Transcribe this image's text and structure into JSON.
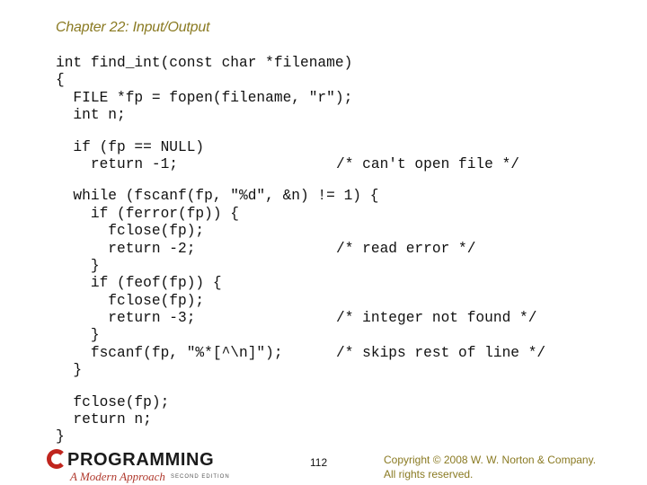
{
  "header": {
    "title": "Chapter 22: Input/Output"
  },
  "code": {
    "lines": [
      {
        "text": "int find_int(const char *filename)",
        "comment": ""
      },
      {
        "text": "{",
        "comment": ""
      },
      {
        "text": "  FILE *fp = fopen(filename, \"r\");",
        "comment": ""
      },
      {
        "text": "  int n;",
        "comment": ""
      },
      {
        "text": "",
        "comment": ""
      },
      {
        "text": "  if (fp == NULL)",
        "comment": ""
      },
      {
        "text": "    return -1;",
        "comment": "/* can't open file */"
      },
      {
        "text": "",
        "comment": ""
      },
      {
        "text": "  while (fscanf(fp, \"%d\", &n) != 1) {",
        "comment": ""
      },
      {
        "text": "    if (ferror(fp)) {",
        "comment": ""
      },
      {
        "text": "      fclose(fp);",
        "comment": ""
      },
      {
        "text": "      return -2;",
        "comment": "/* read error */"
      },
      {
        "text": "    }",
        "comment": ""
      },
      {
        "text": "    if (feof(fp)) {",
        "comment": ""
      },
      {
        "text": "      fclose(fp);",
        "comment": ""
      },
      {
        "text": "      return -3;",
        "comment": "/* integer not found */"
      },
      {
        "text": "    }",
        "comment": ""
      },
      {
        "text": "    fscanf(fp, \"%*[^\\n]\");",
        "comment": "/* skips rest of line */"
      },
      {
        "text": "  }",
        "comment": ""
      },
      {
        "text": "",
        "comment": ""
      },
      {
        "text": "  fclose(fp);",
        "comment": ""
      },
      {
        "text": "  return n;",
        "comment": ""
      },
      {
        "text": "}",
        "comment": ""
      }
    ]
  },
  "footer": {
    "logo_title": "PROGRAMMING",
    "logo_subtitle": "A Modern Approach",
    "logo_edition": "SECOND EDITION",
    "page_number": "112",
    "copyright_line1": "Copyright © 2008 W. W. Norton & Company.",
    "copyright_line2": "All rights reserved."
  }
}
